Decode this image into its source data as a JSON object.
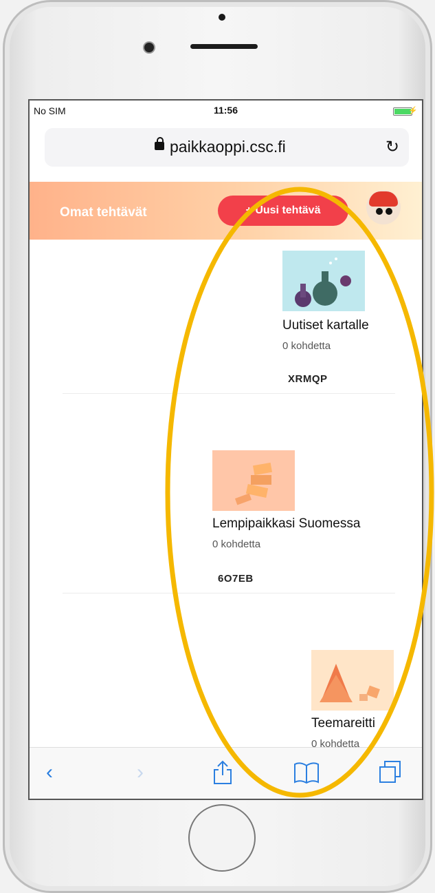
{
  "status": {
    "carrier": "No SIM",
    "time": "11:56"
  },
  "browser": {
    "url": "paikkaoppi.csc.fi"
  },
  "app": {
    "title": "Omat tehtävät",
    "new_task_label": "+ Uusi tehtävä"
  },
  "tasks": [
    {
      "name": "Uutiset kartalle",
      "count": "0 kohdetta",
      "code": "XRMQP",
      "thumb_color": "#bfe8ee"
    },
    {
      "name": "Lempipaikkasi Suomessa",
      "count": "0 kohdetta",
      "code": "6O7EB",
      "thumb_color": "#ffc6a8"
    },
    {
      "name": "Teemareitti",
      "count": "0 kohdetta",
      "code": "",
      "thumb_color": "#ffe5c8"
    }
  ],
  "colors": {
    "accent_button": "#f2404a",
    "annotation": "#f5b800",
    "link_blue": "#2b7fe0"
  },
  "icons": [
    "lock-icon",
    "reload-icon",
    "back-icon",
    "forward-icon",
    "share-icon",
    "bookmarks-icon",
    "tabs-icon"
  ]
}
